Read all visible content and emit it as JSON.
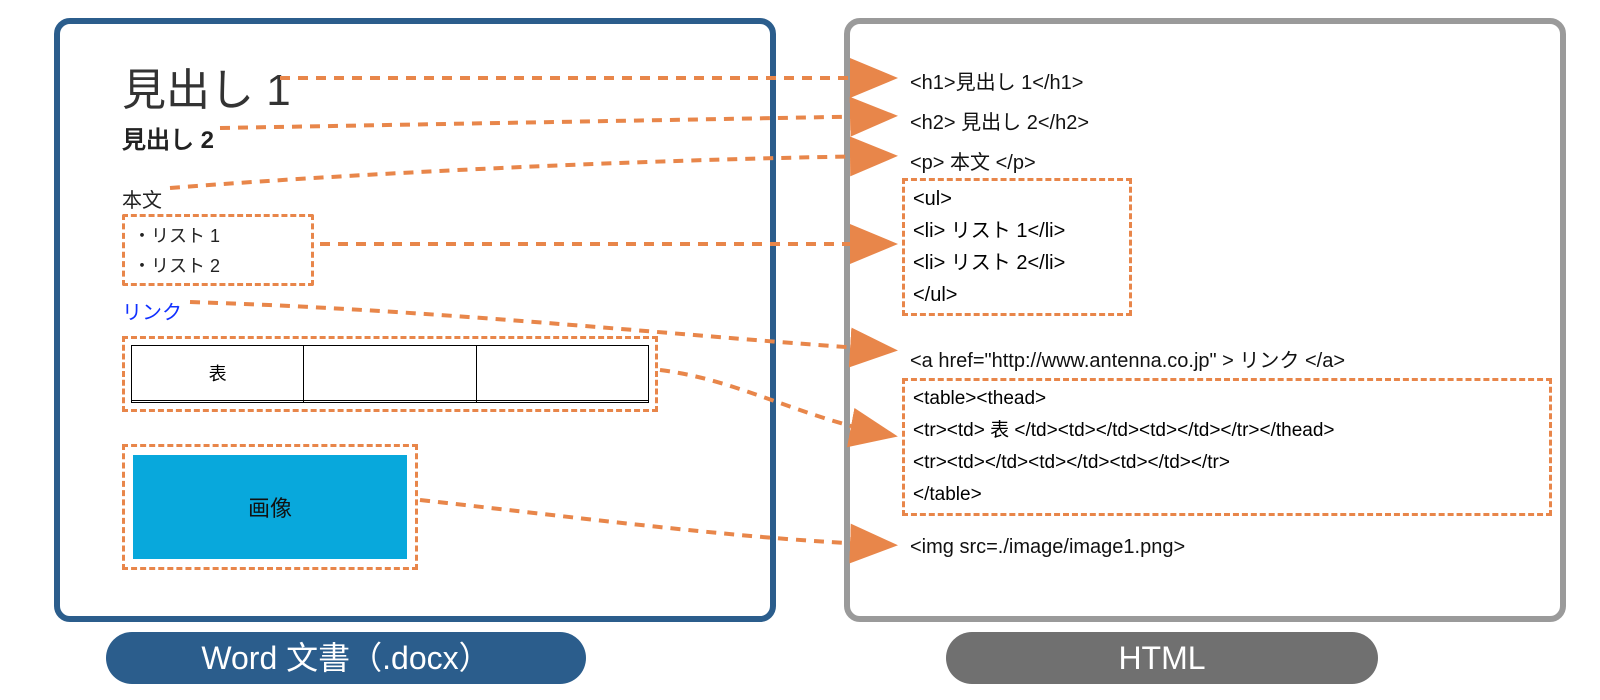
{
  "labels": {
    "word_pill": "Word 文書（.docx）",
    "html_pill": "HTML"
  },
  "word": {
    "h1": "見出し 1",
    "h2": "見出し 2",
    "body": "本文",
    "list": [
      "・リスト 1",
      "・リスト 2"
    ],
    "link": "リンク",
    "table_header": "表",
    "image_label": "画像"
  },
  "html": {
    "h1_code": "<h1>見出し 1</h1>",
    "h2_code": "<h2> 見出し 2</h2>",
    "p_code": "<p> 本文 </p>",
    "ul_open": "<ul>",
    "li1": "<li> リスト 1</li>",
    "li2": "<li> リスト 2</li>",
    "ul_close": "</ul>",
    "a_code": "<a href=\"http://www.antenna.co.jp\" > リンク </a>",
    "table_l1": "<table><thead>",
    "table_l2": "<tr><td> 表 </td><td></td><td></td></tr></thead>",
    "table_l3": "<tr><td></td><td></td><td></td></tr>",
    "table_l4": "</table>",
    "img_code": "<img src=./image/image1.png>"
  }
}
